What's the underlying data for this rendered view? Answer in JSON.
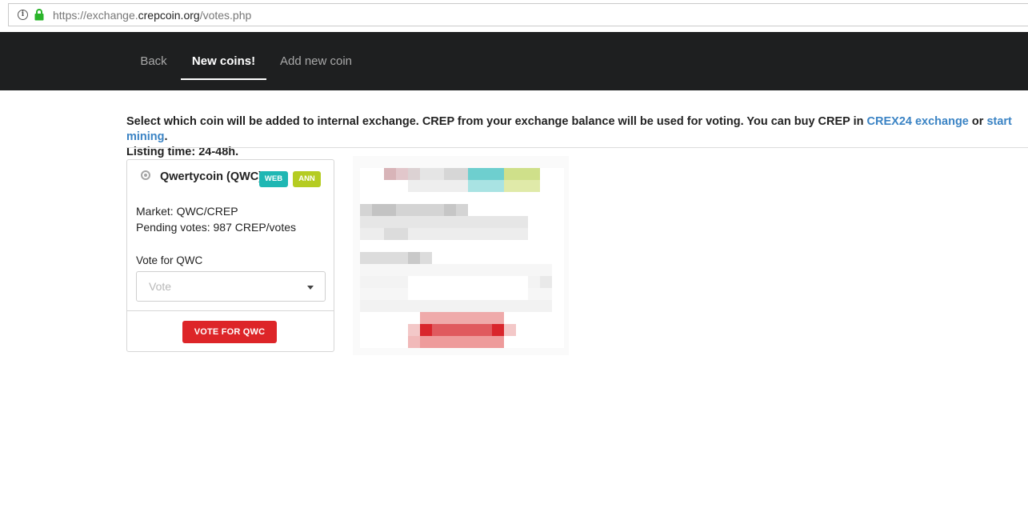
{
  "browser": {
    "url_prefix": "https://exchange.",
    "url_domain": "crepcoin.org",
    "url_path": "/votes.php",
    "info_glyph": "i"
  },
  "nav": {
    "items": [
      {
        "label": "Back"
      },
      {
        "label": "New coins!",
        "active": true
      },
      {
        "label": "Add new coin"
      }
    ]
  },
  "intro": {
    "text_before": "Select which coin will be added to internal exchange. CREP from your exchange balance will be used for voting. You can buy CREP in ",
    "link1": "CREX24 exchange",
    "text_mid": " or ",
    "link2": "start mining",
    "text_after": ".",
    "listing_time": "Listing time: 24-48h."
  },
  "coin_card": {
    "name": "Qwertycoin (QWC)",
    "badge_web": "WEB",
    "badge_ann": "ANN",
    "market_label": "Market:",
    "market_value": " QWC/CREP",
    "pending_label": "Pending votes:",
    "pending_value": " 987 CREP/votes",
    "vote_for_label": "Vote for QWC",
    "select_placeholder": "Vote",
    "vote_button": "VOTE FOR QWC"
  },
  "colors": {
    "nav_bg": "#1e1f20",
    "link": "#3a83c4",
    "badge_web": "#1fb7b3",
    "badge_ann": "#b5cc22",
    "vote_button": "#dd2528"
  }
}
